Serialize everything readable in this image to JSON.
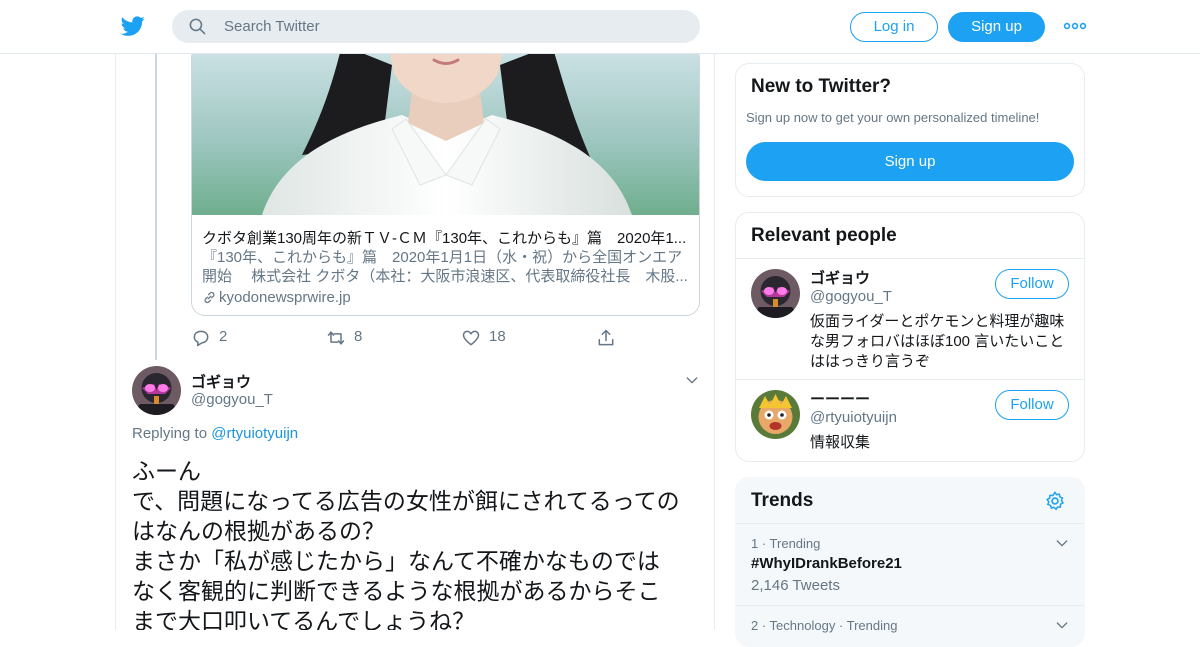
{
  "header": {
    "search_placeholder": "Search Twitter",
    "login_label": "Log in",
    "signup_label": "Sign up",
    "icons": [
      "twitter-logo-icon",
      "search-icon",
      "more-dots-icon"
    ]
  },
  "quoted_card": {
    "title": "クボタ創業130周年の新ＴＶ-ＣＭ『130年、これからも』篇　2020年1...",
    "description_lines": [
      "『130年、これからも』篇　2020年1月1日（水・祝）から全国オンエア",
      "開始　 株式会社 クボタ（本社：大阪市浪速区、代表取締役社長　木股..."
    ],
    "domain": "kyodonewsprwire.jp"
  },
  "actions": {
    "replies": "2",
    "retweets": "8",
    "likes": "18"
  },
  "tweet": {
    "name": "ゴギョウ",
    "handle": "@gogyou_T",
    "replying_label": "Replying to",
    "replying_to": "@rtyuiotyuijn",
    "text_lines": [
      "ふーん",
      "で、問題になってる広告の女性が餌にされてるっての",
      "はなんの根拠があるの？",
      "まさか「私が感じたから」なんて不確かなものでは",
      "なく客観的に判断できるような根拠があるからそこ",
      "まで大口叩いてるんでしょうね？"
    ]
  },
  "sidebar": {
    "new_to_twitter": {
      "title": "New to Twitter?",
      "subtitle": "Sign up now to get your own personalized timeline!",
      "button": "Sign up"
    },
    "relevant_people": {
      "title": "Relevant people",
      "people": [
        {
          "name": "ゴギョウ",
          "handle": "@gogyou_T",
          "bio_lines": [
            "仮面ライダーとポケモンと料理が趣味",
            "な男フォロバはほぼ100 言いたいこと",
            "ははっきり言うぞ"
          ],
          "follow": "Follow"
        },
        {
          "name": "ーーーー",
          "handle": "@rtyuiotyuijn",
          "bio_lines": [
            "情報収集"
          ],
          "follow": "Follow"
        }
      ]
    },
    "trends": {
      "title": "Trends",
      "items": [
        {
          "meta": "1 · Trending",
          "name": "#WhyIDrankBefore21",
          "count": "2,146 Tweets"
        },
        {
          "meta": "2 · Technology · Trending",
          "name": "",
          "count": ""
        }
      ]
    }
  },
  "colors": {
    "accent": "#1da1f2",
    "link": "#1b95e0",
    "muted": "#657786",
    "border": "#e6ecf0"
  }
}
